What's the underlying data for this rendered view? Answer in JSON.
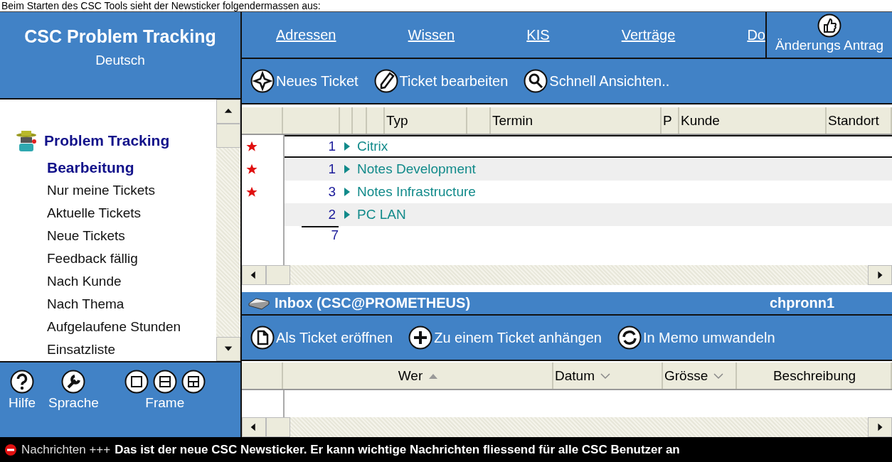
{
  "caption": "Beim Starten des CSC Tools sieht der Newsticker folgendermassen aus:",
  "app": {
    "title": "CSC Problem Tracking",
    "language": "Deutsch"
  },
  "nav_links": [
    "Adressen",
    "Wissen",
    "KIS",
    "Verträge",
    "Do"
  ],
  "change_request": {
    "label": "Änderungs Antrag"
  },
  "toolbar": [
    {
      "kind": "compass",
      "label": "Neues Ticket"
    },
    {
      "kind": "pencil",
      "label": "Ticket bearbeiten"
    },
    {
      "kind": "magnifier",
      "label": "Schnell Ansichten.."
    }
  ],
  "sidebar": {
    "title": "Problem Tracking",
    "items": [
      {
        "label": "Bearbeitung",
        "selected": true
      },
      {
        "label": "Nur meine Tickets",
        "selected": false
      },
      {
        "label": "Aktuelle Tickets",
        "selected": false
      },
      {
        "label": "Neue Tickets",
        "selected": false
      },
      {
        "label": "Feedback fällig",
        "selected": false
      },
      {
        "label": "Nach Kunde",
        "selected": false
      },
      {
        "label": "Nach Thema",
        "selected": false
      },
      {
        "label": "Aufgelaufene Stunden",
        "selected": false
      },
      {
        "label": "Einsatzliste",
        "selected": false
      }
    ]
  },
  "bottom_tools": [
    {
      "kind": "help",
      "label": "Hilfe"
    },
    {
      "kind": "wrench",
      "label": "Sprache"
    },
    {
      "kind": "frames",
      "label": "Frame"
    }
  ],
  "ticket_table": {
    "columns": [
      "Typ",
      "Termin",
      "P",
      "Kunde",
      "Standort"
    ],
    "rows": [
      {
        "flagged": true,
        "count": "1",
        "category": "Citrix",
        "selected": true
      },
      {
        "flagged": true,
        "count": "1",
        "category": "Notes Development",
        "selected": false
      },
      {
        "flagged": true,
        "count": "3",
        "category": "Notes Infrastructure",
        "selected": false
      },
      {
        "flagged": false,
        "count": "2",
        "category": "PC LAN",
        "selected": false
      }
    ],
    "total": "7"
  },
  "inbox": {
    "title": "Inbox (CSC@PROMETHEUS)",
    "user": "chpronn1",
    "toolbar": [
      {
        "kind": "page",
        "label": "Als Ticket eröffnen"
      },
      {
        "kind": "plus",
        "label": "Zu einem Ticket anhängen"
      },
      {
        "kind": "arrows",
        "label": "In Memo umwandeln"
      }
    ],
    "columns": [
      {
        "label": "Wer",
        "sorted": true,
        "menu": false
      },
      {
        "label": "Datum",
        "sorted": false,
        "menu": true
      },
      {
        "label": "Grösse",
        "sorted": false,
        "menu": true
      },
      {
        "label": "Beschreibung",
        "sorted": false,
        "menu": false
      }
    ]
  },
  "news": {
    "label": "Nachrichten +++",
    "message": "Das ist der neue CSC Newsticker. Er kann wichtige Nachrichten fliessend für alle CSC Benutzer an"
  }
}
